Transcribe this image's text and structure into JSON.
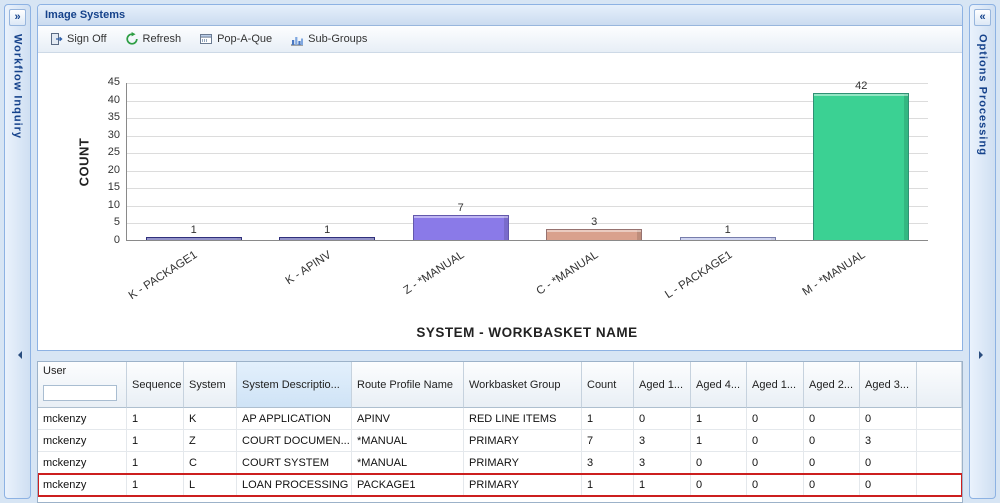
{
  "left_panel": {
    "title": "Workflow Inquiry",
    "expand_glyph": "»"
  },
  "right_panel": {
    "title": "Options Processing",
    "expand_glyph": "«"
  },
  "window": {
    "title": "Image Systems"
  },
  "toolbar": {
    "buttons": [
      {
        "label": "Sign Off",
        "icon": "signoff-icon"
      },
      {
        "label": "Refresh",
        "icon": "refresh-icon"
      },
      {
        "label": "Pop-A-Que",
        "icon": "popaque-icon"
      },
      {
        "label": "Sub-Groups",
        "icon": "subgroups-icon"
      }
    ]
  },
  "chart_data": {
    "type": "bar",
    "categories": [
      "K - PACKAGE1",
      "K - APINV",
      "Z - *MANUAL",
      "C - *MANUAL",
      "L - PACKAGE1",
      "M - *MANUAL"
    ],
    "values": [
      1,
      1,
      7,
      3,
      1,
      42
    ],
    "bar_colors": [
      "#3d3d9e",
      "#3d3d9e",
      "#8a7ae8",
      "#d9a18d",
      "#aab2e6",
      "#3bd193"
    ],
    "title": "",
    "xlabel": "SYSTEM - WORKBASKET NAME",
    "ylabel": "COUNT",
    "ylim": [
      0,
      45
    ],
    "yticks": [
      0,
      5,
      10,
      15,
      20,
      25,
      30,
      35,
      40,
      45
    ],
    "grid": true,
    "legend": "none"
  },
  "table": {
    "columns": [
      "User",
      "Sequence",
      "System",
      "System Descriptio...",
      "Route Profile Name",
      "Workbasket Group",
      "Count",
      "Aged 1...",
      "Aged 4...",
      "Aged 1...",
      "Aged 2...",
      "Aged 3..."
    ],
    "user_filter_value": "",
    "sorted_column_index": 3,
    "highlighted_row_index": 3,
    "rows": [
      [
        "mckenzy",
        "1",
        "K",
        "AP APPLICATION",
        "APINV",
        "RED LINE ITEMS",
        "1",
        "0",
        "1",
        "0",
        "0",
        "0"
      ],
      [
        "mckenzy",
        "1",
        "Z",
        "COURT DOCUMEN...",
        "*MANUAL",
        "PRIMARY",
        "7",
        "3",
        "1",
        "0",
        "0",
        "3"
      ],
      [
        "mckenzy",
        "1",
        "C",
        "COURT SYSTEM",
        "*MANUAL",
        "PRIMARY",
        "3",
        "3",
        "0",
        "0",
        "0",
        "0"
      ],
      [
        "mckenzy",
        "1",
        "L",
        "LOAN PROCESSING",
        "PACKAGE1",
        "PRIMARY",
        "1",
        "1",
        "0",
        "0",
        "0",
        "0"
      ]
    ]
  }
}
